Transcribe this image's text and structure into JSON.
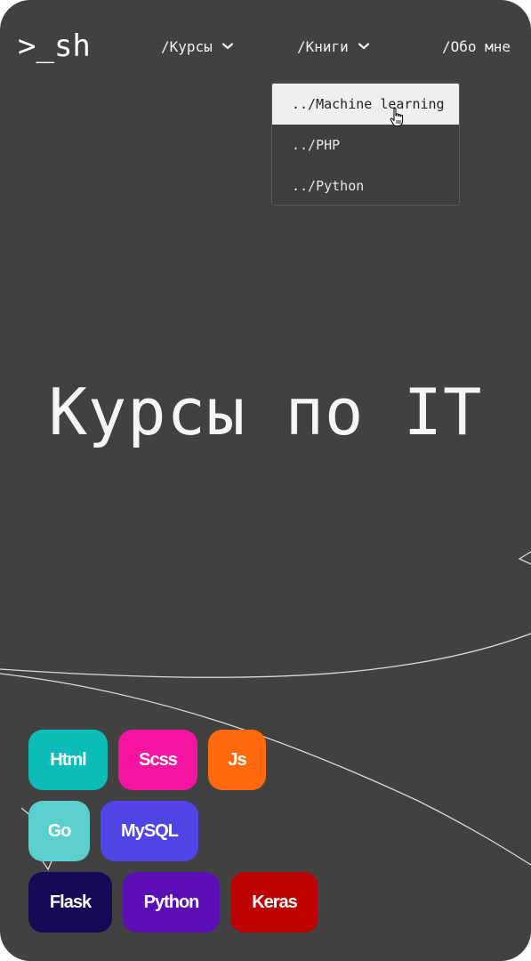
{
  "header": {
    "logo": ">_sh",
    "nav": {
      "courses": "/Курсы",
      "books": "/Книги",
      "about": "/Обо мне"
    }
  },
  "books_dropdown": {
    "items": [
      {
        "label": "../Machine learning",
        "state": "hovered"
      },
      {
        "label": "../PHP"
      },
      {
        "label": "../Python"
      }
    ]
  },
  "hero": {
    "title": "Курсы по IT"
  },
  "tags": [
    {
      "label": "Html",
      "color": "#0bbdb6"
    },
    {
      "label": "Scss",
      "color": "#f514a0"
    },
    {
      "label": "Js",
      "color": "#ff6a10"
    },
    {
      "label": "Go",
      "color": "#5bcfce"
    },
    {
      "label": "MySQL",
      "color": "#5044e6"
    },
    {
      "label": "Flask",
      "color": "#140a55"
    },
    {
      "label": "Python",
      "color": "#5b0fb5"
    },
    {
      "label": "Keras",
      "color": "#bd0202"
    }
  ],
  "icons": {
    "nav_dropdown": "chevron-down-icon",
    "pointer": "hand-pointer-icon"
  },
  "theme": {
    "background": "#414141",
    "text": "#f2f2f2",
    "dropdown_hover_bg": "#efefef"
  }
}
